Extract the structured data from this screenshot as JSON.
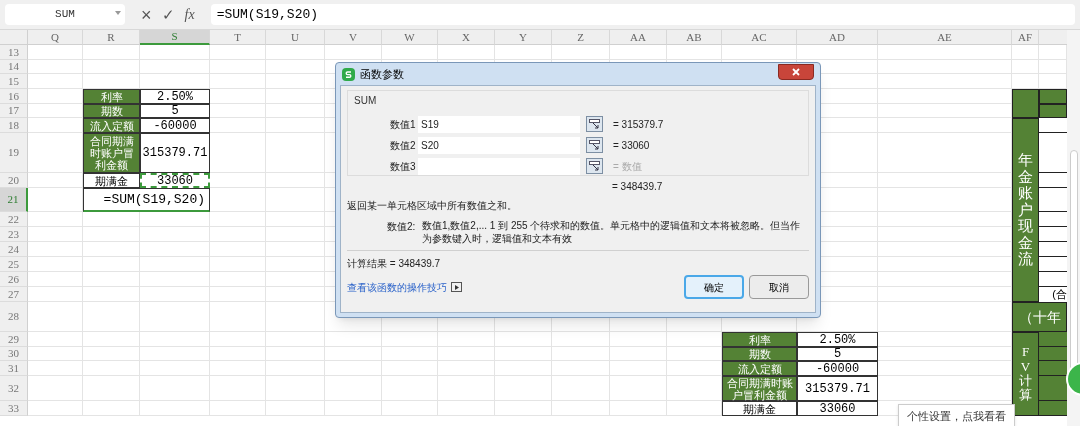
{
  "formula_bar": {
    "name_box": "SUM",
    "cancel_glyph": "×",
    "enter_glyph": "✓",
    "fx_glyph": "fx",
    "formula": "=SUM(S19,S20)"
  },
  "columns": [
    {
      "label": "Q",
      "selected": false
    },
    {
      "label": "R",
      "selected": false
    },
    {
      "label": "S",
      "selected": true
    },
    {
      "label": "T",
      "selected": false
    },
    {
      "label": "U",
      "selected": false
    },
    {
      "label": "V",
      "selected": false
    },
    {
      "label": "W",
      "selected": false
    },
    {
      "label": "X",
      "selected": false
    },
    {
      "label": "Y",
      "selected": false
    },
    {
      "label": "Z",
      "selected": false
    },
    {
      "label": "AA",
      "selected": false
    },
    {
      "label": "AB",
      "selected": false
    },
    {
      "label": "AC",
      "selected": false
    },
    {
      "label": "AD",
      "selected": false
    },
    {
      "label": "AE",
      "selected": false
    },
    {
      "label": "AF",
      "selected": false
    }
  ],
  "rows": [
    {
      "label": "13",
      "selected": false
    },
    {
      "label": "14",
      "selected": false
    },
    {
      "label": "15",
      "selected": false
    },
    {
      "label": "16",
      "selected": false
    },
    {
      "label": "17",
      "selected": false
    },
    {
      "label": "18",
      "selected": false
    },
    {
      "label": "19",
      "selected": false
    },
    {
      "label": "20",
      "selected": false
    },
    {
      "label": "21",
      "selected": true
    },
    {
      "label": "22",
      "selected": false
    },
    {
      "label": "23",
      "selected": false
    },
    {
      "label": "24",
      "selected": false
    },
    {
      "label": "25",
      "selected": false
    },
    {
      "label": "26",
      "selected": false
    },
    {
      "label": "27",
      "selected": false
    },
    {
      "label": "28",
      "selected": false
    },
    {
      "label": "29",
      "selected": false
    },
    {
      "label": "30",
      "selected": false
    },
    {
      "label": "31",
      "selected": false
    },
    {
      "label": "32",
      "selected": false
    },
    {
      "label": "33",
      "selected": false
    }
  ],
  "left_table": {
    "rows": [
      {
        "label": "利率",
        "value": "2.50%",
        "shaded": true,
        "marquee": false
      },
      {
        "label": "期数",
        "value": "5",
        "shaded": true,
        "marquee": false
      },
      {
        "label": "流入定额",
        "value": "-60000",
        "shaded": true,
        "marquee": false
      },
      {
        "label": "合同期满时账户冒利金额",
        "value": "315379.71",
        "shaded": true,
        "marquee": false
      },
      {
        "label": "期满金",
        "value": "33060",
        "shaded": false,
        "marquee": true
      }
    ],
    "formula_cell": "=SUM(S19,S20)"
  },
  "right_table": {
    "rows": [
      {
        "label": "利率",
        "value": "2.50%",
        "shaded": true
      },
      {
        "label": "期数",
        "value": "5",
        "shaded": true
      },
      {
        "label": "流入定额",
        "value": "-60000",
        "shaded": true
      },
      {
        "label": "合同期满时账户冒利金额",
        "value": "315379.71",
        "shaded": true
      },
      {
        "label": "期满金",
        "value": "33060",
        "shaded": false
      }
    ]
  },
  "side_panel": {
    "cashflow_label": "年金账户现金流",
    "partial_label": "(合",
    "band_label": "（十年",
    "calc_label": "FV计算"
  },
  "tooltip": "个性设置，点我看看",
  "dialog": {
    "title": "函数参数",
    "function_name": "SUM",
    "arguments": [
      {
        "label": "数值1",
        "value": "S19",
        "result": "= 315379.7",
        "empty": false
      },
      {
        "label": "数值2",
        "value": "S20",
        "result": "= 33060",
        "empty": false
      },
      {
        "label": "数值3",
        "result": "= 数值",
        "empty": true
      }
    ],
    "total": "= 348439.7",
    "description": "返回某一单元格区域中所有数值之和。",
    "help_label": "数值2:",
    "help_text": "数值1,数值2,... 1 到 255 个待求和的数值。单元格中的逻辑值和文本将被忽略。但当作为参数键入时，逻辑值和文本有效",
    "result_line": "计算结果 = 348439.7",
    "link": "查看该函数的操作技巧",
    "buttons": [
      {
        "label": "确定",
        "focused": true
      },
      {
        "label": "取消",
        "focused": false
      }
    ]
  }
}
